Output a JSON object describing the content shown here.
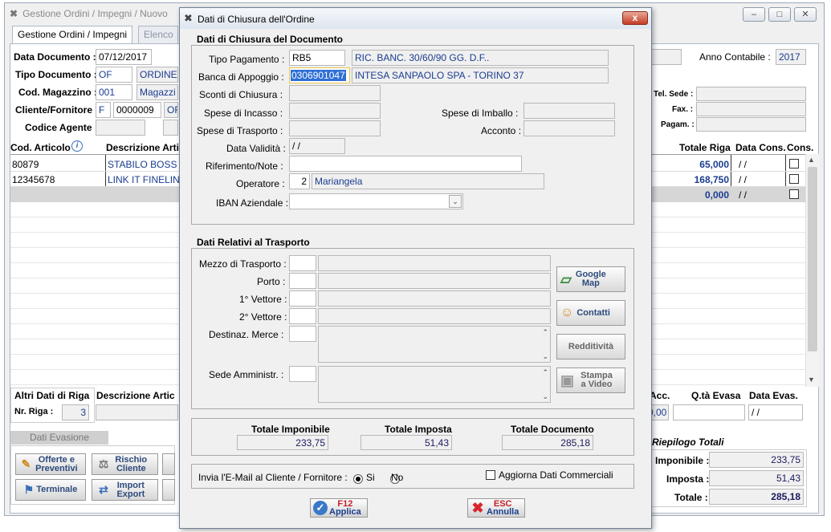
{
  "main": {
    "title": "Gestione Ordini / Impegni / Nuovo",
    "tabs": [
      {
        "label": "Gestione Ordini / Impegni"
      },
      {
        "label": "Elenco"
      }
    ],
    "header": {
      "data_documento_label": "Data Documento :",
      "data_documento": "07/12/2017",
      "tipo_documento_label": "Tipo Documento :",
      "tipo_documento_code": "OF",
      "tipo_documento_desc": "ORDINE",
      "cod_magazzino_label": "Cod. Magazzino :",
      "cod_magazzino_code": "001",
      "cod_magazzino_desc": "Magazzi",
      "cliente_label": "Cliente/Fornitore :",
      "cliente_type": "F",
      "cliente_code": "0000009",
      "cliente_desc": "OF",
      "codice_agente_label": "Codice Agente :",
      "anno_contabile_label": "Anno Contabile :",
      "anno_contabile": "2017",
      "tel_sede_label": "Tel. Sede :",
      "fax_label": "Fax. :",
      "pagam_label": "Pagam. :"
    },
    "grid": {
      "col_cod_articolo": "Cod. Articolo",
      "col_descrizione": "Descrizione Arti",
      "col_totale_riga": "Totale Riga",
      "col_data_cons": "Data Cons.",
      "col_cons": "Cons.",
      "rows": [
        {
          "cod": "80879",
          "desc": "STABILO BOSS",
          "totale": "65,000",
          "data_cons": "/ /"
        },
        {
          "cod": "12345678",
          "desc": "LINK IT FINELIN",
          "totale": "168,750",
          "data_cons": "/ /"
        },
        {
          "cod": "",
          "desc": "",
          "totale": "0,000",
          "data_cons": "/ /"
        }
      ]
    },
    "bottom": {
      "altri_dati_label": "Altri Dati di Riga",
      "descrizione_label": "Descrizione Artic",
      "nr_riga_label": "Nr. Riga :",
      "nr_riga": "3",
      "acc_label": "Acc.",
      "qta_evasa_label": "Q.tà Evasa",
      "data_evas_label": "Data Evas.",
      "acc_value": "0,00",
      "data_evas_value": "/ /",
      "dati_evasione_label": "Dati Evasione"
    },
    "buttons": {
      "offerte": "Offerte e Preventivi",
      "rischio": "Rischio Cliente",
      "terminale": "Terminale",
      "import": "Import Export"
    },
    "riepilogo": {
      "title": "Riepilogo Totali",
      "imponibile_label": "Imponibile :",
      "imponibile": "233,75",
      "imposta_label": "Imposta :",
      "imposta": "51,43",
      "totale_label": "Totale :",
      "totale": "285,18"
    }
  },
  "dialog": {
    "title": "Dati di Chiusura dell'Ordine",
    "close_label": "x",
    "doc_section": {
      "title": "Dati di Chiusura del Documento",
      "tipo_pagamento_label": "Tipo Pagamento :",
      "tipo_pagamento_code": "RB5",
      "tipo_pagamento_desc": "RIC. BANC. 30/60/90 GG. D.F..",
      "banca_label": "Banca di Appoggio :",
      "banca_code": "0306901047",
      "banca_desc": "INTESA SANPAOLO SPA - TORINO 37",
      "sconti_label": "Sconti di Chiusura :",
      "spese_incasso_label": "Spese di Incasso :",
      "spese_imballo_label": "Spese di Imballo :",
      "spese_trasporto_label": "Spese di Trasporto :",
      "acconto_label": "Acconto :",
      "data_validita_label": "Data Validità :",
      "data_validita": " / /",
      "riferimento_label": "Riferimento/Note :",
      "operatore_label": "Operatore :",
      "operatore_code": "2",
      "operatore_name": "Mariangela",
      "iban_label": "IBAN Aziendale :"
    },
    "transport_section": {
      "title": "Dati Relativi al Trasporto",
      "mezzo_label": "Mezzo di Trasporto :",
      "porto_label": "Porto :",
      "vettore1_label": "1° Vettore :",
      "vettore2_label": "2° Vettore :",
      "destinaz_label": "Destinaz. Merce :",
      "sede_label": "Sede Amministr. :",
      "google_map": "Google Map",
      "contatti": "Contatti",
      "redditivita": "Redditività",
      "stampa_video": "Stampa a Video"
    },
    "totals": {
      "imponibile_label": "Totale Imponibile",
      "imponibile": "233,75",
      "imposta_label": "Totale Imposta",
      "imposta": "51,43",
      "documento_label": "Totale Documento",
      "documento": "285,18"
    },
    "email": {
      "label": "Invia l'E-Mail al Cliente / Fornitore :",
      "si": "Si",
      "no": "No",
      "aggiorna_label": "Aggiorna Dati Commerciali"
    },
    "actions": {
      "applica_key": "F12",
      "applica": "Applica",
      "annulla_key": "ESC",
      "annulla": "Annulla"
    }
  }
}
